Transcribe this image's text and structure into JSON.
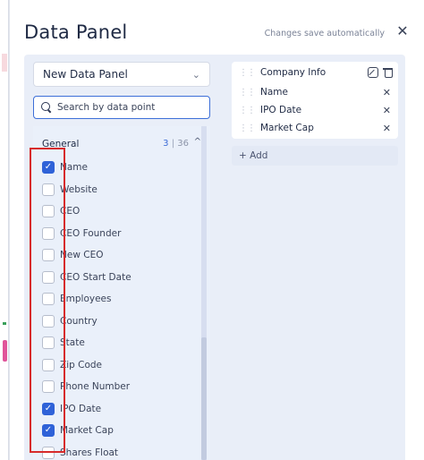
{
  "header": {
    "title": "Data Panel",
    "autosave_note": "Changes save automatically",
    "close_glyph": "✕"
  },
  "left": {
    "panel_select": {
      "value": "New Data Panel",
      "chevron": "⌄"
    },
    "search": {
      "placeholder": "Search by data point"
    },
    "group": {
      "name": "General",
      "selected_count": "3",
      "separator": "|",
      "total_count": "36",
      "caret": "^",
      "items": [
        {
          "label": "Name",
          "checked": true
        },
        {
          "label": "Website",
          "checked": false
        },
        {
          "label": "CEO",
          "checked": false
        },
        {
          "label": "CEO Founder",
          "checked": false
        },
        {
          "label": "New CEO",
          "checked": false
        },
        {
          "label": "CEO Start Date",
          "checked": false
        },
        {
          "label": "Employees",
          "checked": false
        },
        {
          "label": "Country",
          "checked": false
        },
        {
          "label": "State",
          "checked": false
        },
        {
          "label": "Zip Code",
          "checked": false
        },
        {
          "label": "Phone Number",
          "checked": false
        },
        {
          "label": "IPO Date",
          "checked": true
        },
        {
          "label": "Market Cap",
          "checked": true
        },
        {
          "label": "Shares Float",
          "checked": false
        }
      ]
    }
  },
  "right": {
    "card": {
      "title": "Company Info",
      "fields": [
        {
          "label": "Name",
          "remove_glyph": "✕"
        },
        {
          "label": "IPO Date",
          "remove_glyph": "✕"
        },
        {
          "label": "Market Cap",
          "remove_glyph": "✕"
        }
      ]
    },
    "add_label": "+ Add"
  },
  "colors": {
    "accent": "#2f62d8",
    "panel_bg": "#e9eef8",
    "highlight": "#d72b2b"
  }
}
